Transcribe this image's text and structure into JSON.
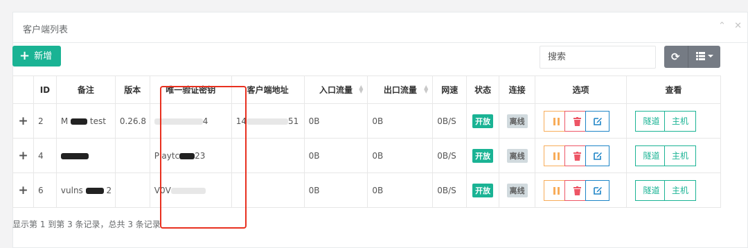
{
  "panel": {
    "title": "客户端列表",
    "collapse_icon": "chevron-up-icon",
    "close_icon": "close-icon"
  },
  "toolbar": {
    "add_label": "新增",
    "search_placeholder": "搜索"
  },
  "table": {
    "headers": [
      "ID",
      "备注",
      "版本",
      "唯一验证密钥",
      "客户端地址",
      "入口流量",
      "出口流量",
      "网速",
      "状态",
      "连接",
      "选项",
      "查看"
    ],
    "rows": [
      {
        "id": "2",
        "remark_a": "M",
        "remark_b": "test",
        "version": "0.26.8",
        "key_a": "",
        "key_b": "4",
        "addr_a": "14",
        "addr_b": "51",
        "inflow": "0B",
        "outflow": "0B",
        "speed": "0B/S",
        "status": "开放",
        "conn": "离线"
      },
      {
        "id": "4",
        "remark_a": "",
        "remark_b": "",
        "version": "",
        "key_a": "Playtc",
        "key_b": "23",
        "addr_a": "",
        "addr_b": "",
        "inflow": "0B",
        "outflow": "0B",
        "speed": "0B/S",
        "status": "开放",
        "conn": "离线"
      },
      {
        "id": "6",
        "remark_a": "vulns",
        "remark_b": "2",
        "version": "",
        "key_a": "V0V",
        "key_b": "",
        "addr_a": "",
        "addr_b": "",
        "inflow": "0B",
        "outflow": "0B",
        "speed": "0B/S",
        "status": "开放",
        "conn": "离线"
      }
    ],
    "view_tunnel": "隧道",
    "view_host": "主机"
  },
  "footer": "显示第 1 到第 3 条记录，总共 3 条记录",
  "colors": {
    "primary": "#1ab394",
    "info": "#1c84c6",
    "warning": "#f8ac59",
    "danger": "#ed5565",
    "highlight": "#e8301f"
  }
}
